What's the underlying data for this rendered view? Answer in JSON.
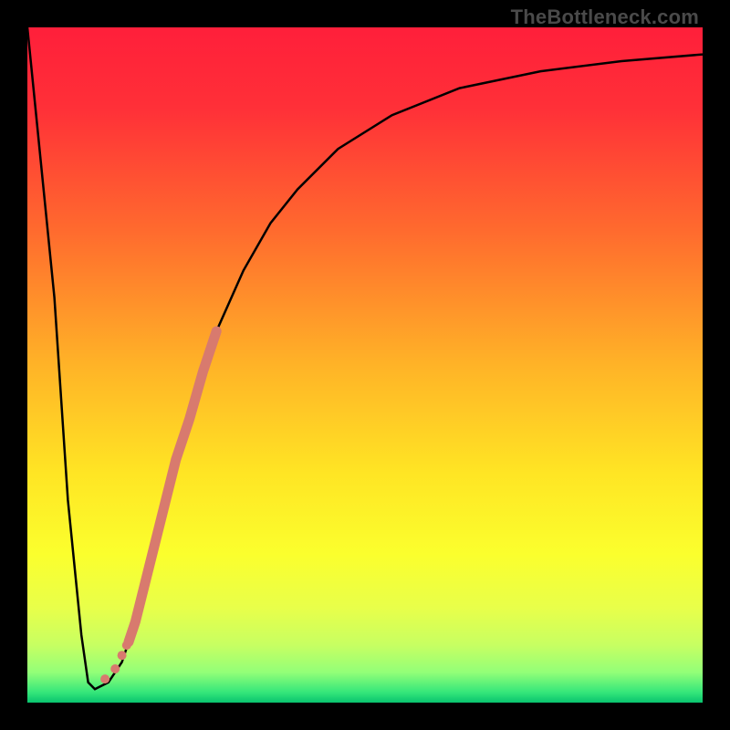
{
  "watermark": "TheBottleneck.com",
  "chart_data": {
    "type": "line",
    "title": "",
    "xlabel": "",
    "ylabel": "",
    "xlim": [
      0,
      100
    ],
    "ylim": [
      0,
      100
    ],
    "gradient_stops": [
      {
        "offset": 0,
        "color": "#ff1f3a"
      },
      {
        "offset": 0.12,
        "color": "#ff3038"
      },
      {
        "offset": 0.3,
        "color": "#ff6a2e"
      },
      {
        "offset": 0.5,
        "color": "#ffb327"
      },
      {
        "offset": 0.66,
        "color": "#ffe524"
      },
      {
        "offset": 0.78,
        "color": "#fbff2d"
      },
      {
        "offset": 0.86,
        "color": "#e8ff4a"
      },
      {
        "offset": 0.915,
        "color": "#c7ff62"
      },
      {
        "offset": 0.955,
        "color": "#93ff78"
      },
      {
        "offset": 0.985,
        "color": "#34e67a"
      },
      {
        "offset": 1.0,
        "color": "#09c36f"
      }
    ],
    "series": [
      {
        "name": "bottleneck-curve",
        "x": [
          0,
          4,
          6,
          8,
          9,
          10,
          12,
          14,
          16,
          18,
          20,
          22,
          25,
          28,
          32,
          36,
          40,
          46,
          54,
          64,
          76,
          88,
          100
        ],
        "y": [
          100,
          60,
          30,
          10,
          3,
          2,
          3,
          6,
          12,
          20,
          28,
          36,
          46,
          55,
          64,
          71,
          76,
          82,
          87,
          91,
          93.5,
          95,
          96
        ]
      }
    ],
    "highlight_segment": {
      "series": "bottleneck-curve",
      "x": [
        15,
        16,
        18,
        20,
        22,
        24,
        26,
        28
      ],
      "y": [
        9,
        12,
        20,
        28,
        36,
        42,
        49,
        55
      ],
      "color": "#d87a6e",
      "width": 11
    },
    "highlight_points": {
      "series": "bottleneck-curve",
      "points": [
        {
          "x": 11.5,
          "y": 3.5,
          "r": 5
        },
        {
          "x": 13.0,
          "y": 5.0,
          "r": 5
        },
        {
          "x": 14.0,
          "y": 7.0,
          "r": 5
        },
        {
          "x": 14.7,
          "y": 8.5,
          "r": 5
        }
      ],
      "color": "#d87a6e"
    }
  }
}
